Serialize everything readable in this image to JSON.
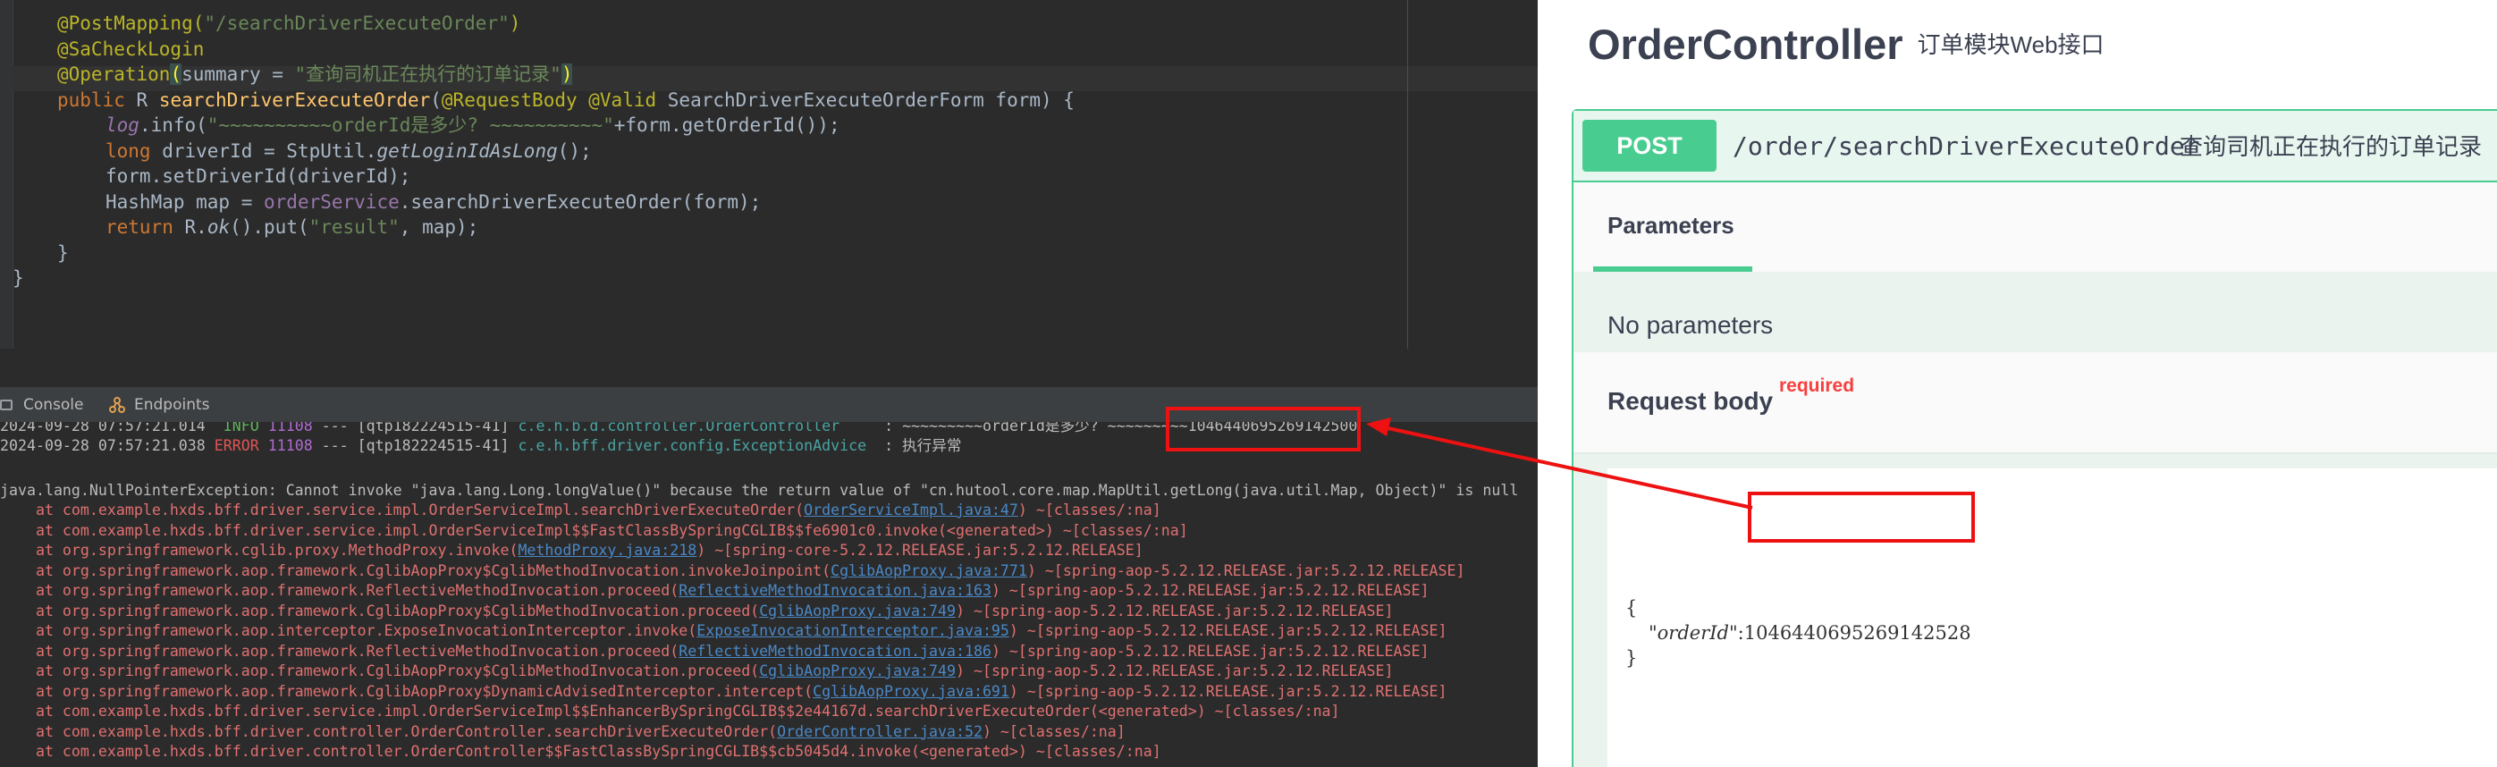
{
  "editor": {
    "lines": [
      {
        "parts": [
          {
            "c": "ann",
            "t": "@PostMapping("
          },
          {
            "c": "str",
            "t": "\"/searchDriverExecuteOrder\""
          },
          {
            "c": "ann",
            "t": ")"
          }
        ]
      },
      {
        "parts": [
          {
            "c": "ann",
            "t": "@SaCheckLogin"
          }
        ]
      },
      {
        "parts": [
          {
            "c": "ann",
            "t": "@Operation"
          },
          {
            "c": "brk",
            "t": "("
          },
          {
            "c": "",
            "t": "summary = "
          },
          {
            "c": "str",
            "t": "\"查询司机正在执行的订单记录\""
          },
          {
            "c": "brk",
            "t": ")"
          }
        ]
      },
      {
        "parts": [
          {
            "c": "kw",
            "t": "public "
          },
          {
            "c": "",
            "t": "R "
          },
          {
            "c": "fn",
            "t": "searchDriverExecuteOrder"
          },
          {
            "c": "",
            "t": "("
          },
          {
            "c": "ann",
            "t": "@RequestBody @Valid "
          },
          {
            "c": "",
            "t": "SearchDriverExecuteOrderForm form) {"
          }
        ]
      },
      {
        "parts": [
          {
            "c": "fld it",
            "t": "log"
          },
          {
            "c": "",
            "t": ".info("
          },
          {
            "c": "str",
            "t": "\"~~~~~~~~~~orderId是多少? ~~~~~~~~~~\""
          },
          {
            "c": "",
            "t": "+form.getOrderId());"
          }
        ]
      },
      {
        "parts": [
          {
            "c": "kw",
            "t": "long "
          },
          {
            "c": "",
            "t": "driverId = StpUtil."
          },
          {
            "c": "it",
            "t": "getLoginIdAsLong"
          },
          {
            "c": "",
            "t": "();"
          }
        ]
      },
      {
        "parts": [
          {
            "c": "",
            "t": "form.setDriverId(driverId);"
          }
        ]
      },
      {
        "parts": [
          {
            "c": "",
            "t": "HashMap map = "
          },
          {
            "c": "fld",
            "t": "orderService"
          },
          {
            "c": "",
            "t": ".searchDriverExecuteOrder(form);"
          }
        ]
      },
      {
        "parts": [
          {
            "c": "kw",
            "t": "return "
          },
          {
            "c": "",
            "t": "R."
          },
          {
            "c": "it",
            "t": "ok"
          },
          {
            "c": "",
            "t": "().put("
          },
          {
            "c": "str",
            "t": "\"result\""
          },
          {
            "c": "",
            "t": ", map);"
          }
        ]
      },
      {
        "parts": [
          {
            "c": "",
            "t": "}"
          }
        ]
      },
      {
        "parts": [
          {
            "c": "",
            "t": "}"
          }
        ]
      }
    ]
  },
  "tool_tabs": {
    "console": "Console",
    "endpoints": "Endpoints"
  },
  "console": {
    "log_lines": [
      {
        "parts": [
          {
            "c": "",
            "t": "2024-09-28 07:57:21.014  "
          },
          {
            "c": "info",
            "t": "INFO"
          },
          {
            "c": "",
            "t": " "
          },
          {
            "c": "pid",
            "t": "11108"
          },
          {
            "c": "",
            "t": " --- [qtp182224515-41] "
          },
          {
            "c": "cls",
            "t": "c.e.h.b.d.controller.OrderController    "
          },
          {
            "c": "",
            "t": " : ~~~~~~~~~orderId是多少? ~~~~~~~~~1046440695269142500"
          }
        ]
      },
      {
        "parts": [
          {
            "c": "",
            "t": "2024-09-28 07:57:21.038 "
          },
          {
            "c": "err",
            "t": "ERROR"
          },
          {
            "c": "",
            "t": " "
          },
          {
            "c": "pid",
            "t": "11108"
          },
          {
            "c": "",
            "t": " --- [qtp182224515-41] "
          },
          {
            "c": "cls",
            "t": "c.e.h.bff.driver.config.ExceptionAdvice"
          },
          {
            "c": "",
            "t": "  : 执行异常"
          }
        ]
      }
    ],
    "exception": "java.lang.NullPointerException: Cannot invoke \"java.lang.Long.longValue()\" because the return value of \"cn.hutool.core.map.MapUtil.getLong(java.util.Map, Object)\" is null",
    "stack": [
      {
        "pre": "    at com.example.hxds.bff.driver.service.impl.OrderServiceImpl.searchDriverExecuteOrder(",
        "link": "OrderServiceImpl.java:47",
        "post": ") ~[classes/:na]"
      },
      {
        "pre": "    at com.example.hxds.bff.driver.service.impl.OrderServiceImpl$$FastClassBySpringCGLIB$$fe6901c0.invoke(<generated>) ~[classes/:na]",
        "link": "",
        "post": ""
      },
      {
        "pre": "    at org.springframework.cglib.proxy.MethodProxy.invoke(",
        "link": "MethodProxy.java:218",
        "post": ") ~[spring-core-5.2.12.RELEASE.jar:5.2.12.RELEASE]"
      },
      {
        "pre": "    at org.springframework.aop.framework.CglibAopProxy$CglibMethodInvocation.invokeJoinpoint(",
        "link": "CglibAopProxy.java:771",
        "post": ") ~[spring-aop-5.2.12.RELEASE.jar:5.2.12.RELEASE]"
      },
      {
        "pre": "    at org.springframework.aop.framework.ReflectiveMethodInvocation.proceed(",
        "link": "ReflectiveMethodInvocation.java:163",
        "post": ") ~[spring-aop-5.2.12.RELEASE.jar:5.2.12.RELEASE]"
      },
      {
        "pre": "    at org.springframework.aop.framework.CglibAopProxy$CglibMethodInvocation.proceed(",
        "link": "CglibAopProxy.java:749",
        "post": ") ~[spring-aop-5.2.12.RELEASE.jar:5.2.12.RELEASE]"
      },
      {
        "pre": "    at org.springframework.aop.interceptor.ExposeInvocationInterceptor.invoke(",
        "link": "ExposeInvocationInterceptor.java:95",
        "post": ") ~[spring-aop-5.2.12.RELEASE.jar:5.2.12.RELEASE]"
      },
      {
        "pre": "    at org.springframework.aop.framework.ReflectiveMethodInvocation.proceed(",
        "link": "ReflectiveMethodInvocation.java:186",
        "post": ") ~[spring-aop-5.2.12.RELEASE.jar:5.2.12.RELEASE]"
      },
      {
        "pre": "    at org.springframework.aop.framework.CglibAopProxy$CglibMethodInvocation.proceed(",
        "link": "CglibAopProxy.java:749",
        "post": ") ~[spring-aop-5.2.12.RELEASE.jar:5.2.12.RELEASE]"
      },
      {
        "pre": "    at org.springframework.aop.framework.CglibAopProxy$DynamicAdvisedInterceptor.intercept(",
        "link": "CglibAopProxy.java:691",
        "post": ") ~[spring-aop-5.2.12.RELEASE.jar:5.2.12.RELEASE]"
      },
      {
        "pre": "    at com.example.hxds.bff.driver.service.impl.OrderServiceImpl$$EnhancerBySpringCGLIB$$2e44167d.searchDriverExecuteOrder(<generated>) ~[classes/:na]",
        "link": "",
        "post": ""
      },
      {
        "pre": "    at com.example.hxds.bff.driver.controller.OrderController.searchDriverExecuteOrder(",
        "link": "OrderController.java:52",
        "post": ") ~[classes/:na]"
      },
      {
        "pre": "    at com.example.hxds.bff.driver.controller.OrderController$$FastClassBySpringCGLIB$$cb5045d4.invoke(<generated>) ~[classes/:na]",
        "link": "",
        "post": ""
      }
    ]
  },
  "swagger": {
    "title": "OrderController",
    "description": "订单模块Web接口",
    "method": "POST",
    "path": "/order/searchDriverExecuteOrder",
    "summary": "查询司机正在执行的订单记录",
    "parameters_tab": "Parameters",
    "no_parameters": "No parameters",
    "request_body_label": "Request body",
    "required_label": "required",
    "body_open": "{",
    "body_key": "\"orderId\"",
    "body_colon": ":",
    "body_value": "1046440695269142528",
    "body_close": "}"
  },
  "colors": {
    "post": "#49cc90",
    "highlight": "#ee1111",
    "ide_bg": "#2b2b2b"
  }
}
